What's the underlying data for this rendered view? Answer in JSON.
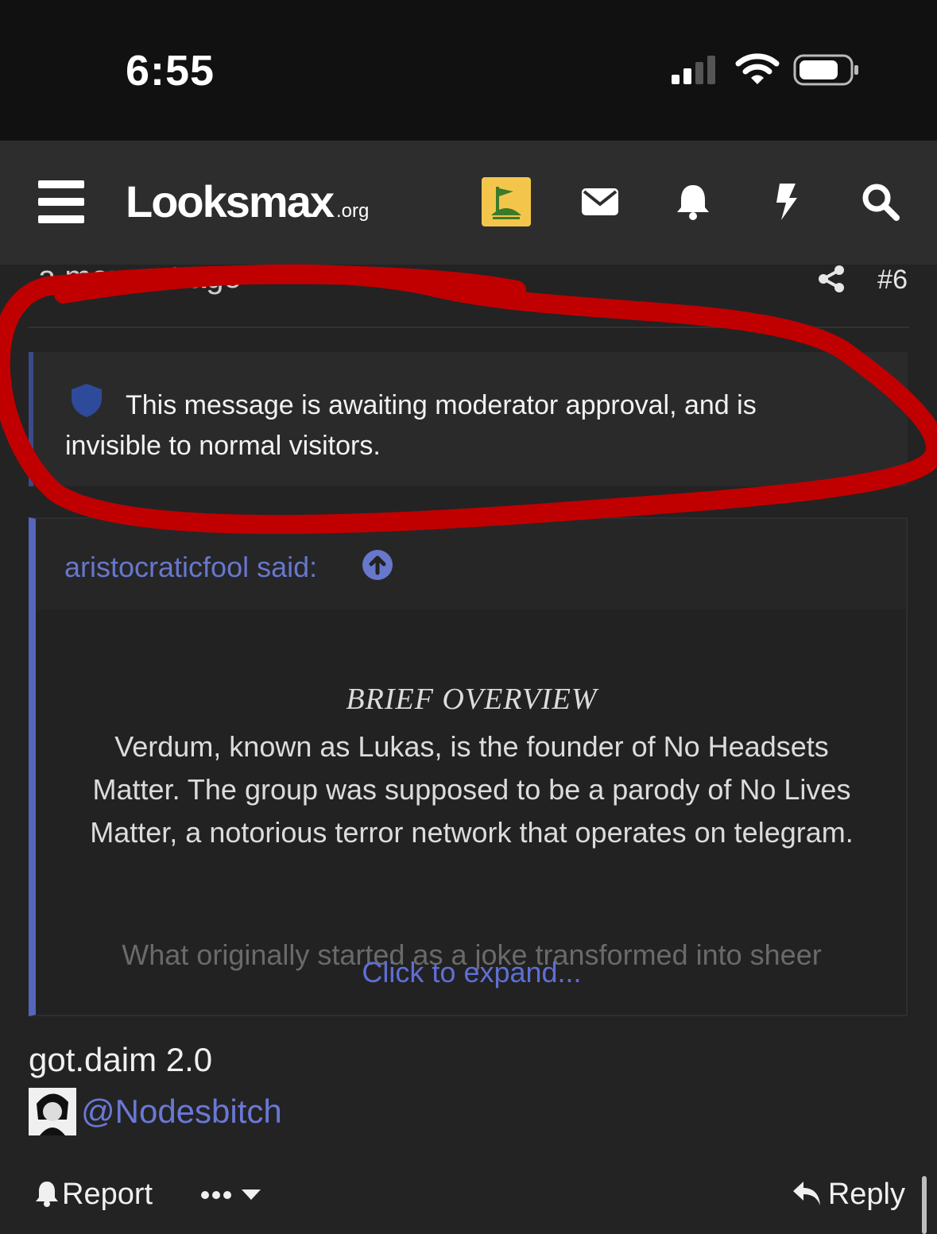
{
  "status_bar": {
    "time": "6:55"
  },
  "navbar": {
    "logo_text": "Looksmax",
    "logo_suffix": ".org",
    "icons": [
      "menu-icon",
      "user-avatar",
      "envelope-icon",
      "bell-icon",
      "lightning-icon",
      "search-icon"
    ]
  },
  "post": {
    "time": "a moment ago",
    "number": "#6",
    "moderation_notice": "This message is awaiting moderator approval, and is invisible to normal visitors.",
    "quote": {
      "author": "aristocraticfool said:",
      "title": "BRIEF OVERVIEW",
      "body": "Verdum, known as Lukas, is the founder of No Headsets Matter. The group was supposed to be a parody of No Lives Matter, a notorious terror network that operates on telegram.",
      "faded_line": "What originally started as a joke transformed into sheer",
      "expand_label": "Click to expand..."
    },
    "text": "got.daim 2.0",
    "signature_mention": "@Nodesbitch"
  },
  "actions": {
    "report_label": "Report",
    "reply_label": "Reply"
  },
  "colors": {
    "accent_link": "#6777cc",
    "quote_border": "#5566bb",
    "annotation_red": "#c00000",
    "avatar_bg": "#f3c64b"
  }
}
